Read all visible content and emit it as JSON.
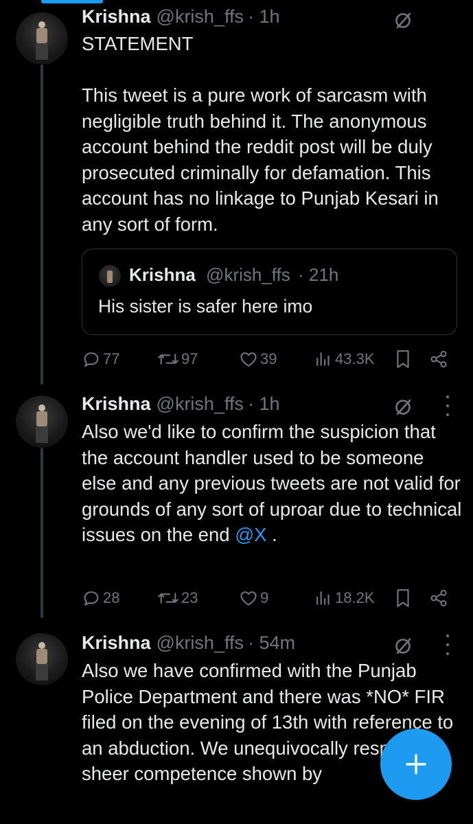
{
  "colors": {
    "background": "#000000",
    "text": "#e7e9ea",
    "muted": "#71767b",
    "accent": "#1d9bf0",
    "border": "#2f3336"
  },
  "tweets": [
    {
      "name": "Krishna",
      "handle": "@krish_ffs",
      "time": "· 1h",
      "body": [
        "STATEMENT",
        "",
        "This tweet is a pure work of sarcasm with negligible truth behind it. The anonymous account behind the reddit post will be duly prosecuted criminally for defamation. This account has no linkage to Punjab Kesari in any sort of form."
      ],
      "quote": {
        "name": "Krishna",
        "handle": "@krish_ffs",
        "time": "· 21h",
        "text": "His sister is safer here imo"
      },
      "stats": {
        "replies": "77",
        "reposts": "97",
        "likes": "39",
        "views": "43.3K"
      }
    },
    {
      "name": "Krishna",
      "handle": "@krish_ffs",
      "time": "· 1h",
      "body_text": "Also we'd like to confirm the suspicion that the account handler used to be someone else and any previous tweets are not valid for grounds of any sort of uproar due to technical issues on the end",
      "mention": "@X",
      "body_suffix": " .",
      "stats": {
        "replies": "28",
        "reposts": "23",
        "likes": "9",
        "views": "18.2K"
      }
    },
    {
      "name": "Krishna",
      "handle": "@krish_ffs",
      "time": "· 54m",
      "body_text": "Also we have confirmed with the Punjab Police Department and there was *NO* FIR filed on the evening of 13th with reference to an abduction. We unequivocally respect the sheer competence shown by"
    }
  ],
  "icons": {
    "reply": "reply-icon",
    "repost": "repost-icon",
    "like": "like-icon",
    "views": "views-icon",
    "bookmark": "bookmark-icon",
    "share": "share-icon",
    "grok": "grok-icon",
    "more": "more-icon",
    "compose": "plus-icon"
  }
}
